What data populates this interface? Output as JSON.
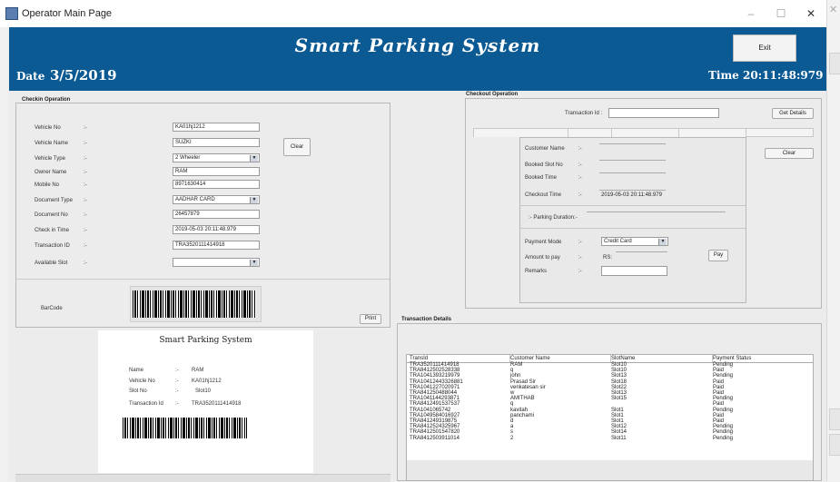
{
  "window": {
    "title": "Operator Main Page",
    "minimize": "–",
    "maximize": "☐",
    "close": "✕"
  },
  "header": {
    "brand": "Smart Parking System",
    "exit_label": "Exit",
    "date_label": "Date",
    "date_value": "3/5/2019",
    "time_label": "Time",
    "time_value": "20:11:48:979"
  },
  "checkin": {
    "title": "Checkin Operation",
    "fields": [
      {
        "label": "Vehicle No",
        "sep": ":-",
        "value": "KA01hj1212",
        "kind": "text"
      },
      {
        "label": "Vehicle Name",
        "sep": ":-",
        "value": "SUZKI",
        "kind": "text"
      },
      {
        "label": "Vehicle Type",
        "sep": ":-",
        "value": "2 Wheeler",
        "kind": "combo"
      },
      {
        "label": "Owner Name",
        "sep": ":-",
        "value": "RAM",
        "kind": "text"
      },
      {
        "label": "Mobile No",
        "sep": ":-",
        "value": "8971630414",
        "kind": "text"
      },
      {
        "label": "Document Type",
        "sep": ":-",
        "value": "AADHAR CARD",
        "kind": "combo"
      },
      {
        "label": "Document No",
        "sep": ":-",
        "value": "26457879",
        "kind": "text"
      },
      {
        "label": "Check in Time",
        "sep": ":-",
        "value": "2019-05-03 20:11:48.979",
        "kind": "text"
      },
      {
        "label": "Transaction ID",
        "sep": ":-",
        "value": "TRA3520111414918",
        "kind": "text"
      },
      {
        "label": "Available Slot",
        "sep": ":-",
        "value": "",
        "kind": "combo"
      }
    ],
    "clear_label": "Clear",
    "barcode_label": "BarCode",
    "print_label": "Print"
  },
  "ticket": {
    "title": "Smart Parking System",
    "rows": [
      {
        "label": "Name",
        "sep": ":-",
        "value": "RAM"
      },
      {
        "label": "Vehicle No",
        "sep": ":-",
        "value": "KA01hj1212"
      },
      {
        "label": "Slot No",
        "sep": ":-",
        "value": "Slot10"
      },
      {
        "label": "Transaction Id",
        "sep": ":-",
        "value": "TRA3520111414918"
      }
    ]
  },
  "checkout": {
    "title": "Checkout Operation",
    "transaction_label": "Transaction Id :",
    "transaction_value": "",
    "get_details_label": "Get Details",
    "clear_label": "Clear",
    "customer_name_label": "Customer Name",
    "customer_name_sep": ":-",
    "booked_slot_label": "Booked Slot No",
    "booked_slot_sep": ":-",
    "booked_time_label": "Booked Time",
    "booked_time_sep": ":-",
    "checkout_time_label": "Checkout Time",
    "checkout_time_sep": ":-",
    "checkout_time_value": "2019-05-03 20:11:48.979",
    "duration_label": ":- Parking Duration:-",
    "payment_mode_label": "Payment Mode",
    "payment_mode_sep": ":-",
    "payment_mode_value": "Credit Card",
    "amount_label": "Amount to pay",
    "amount_sep": ":-",
    "currency": "RS:",
    "pay_label": "Pay",
    "remarks_label": "Remarks",
    "remarks_sep": ":-"
  },
  "transactions": {
    "title": "Transaction Details",
    "columns": [
      "TransId",
      "Customer Name",
      "SlotName",
      "Payment Status"
    ],
    "rows": [
      [
        "TRA3520111414918",
        "RAM",
        "Slot10",
        "Pending"
      ],
      [
        "TRA8412502528338",
        "q",
        "Slot10",
        "Paid"
      ],
      [
        "TRA1041393219979",
        "john",
        "Slot13",
        "Pending"
      ],
      [
        "TRA10412443326881",
        "Prasad Sir",
        "Slot18",
        "Paid"
      ],
      [
        "TRA1041227020971",
        "venkatesan sir",
        "Slot22",
        "Paid"
      ],
      [
        "TRA841250488044",
        "w",
        "Slot13",
        "Paid"
      ],
      [
        "TRA1041144293871",
        "AMITHAB",
        "Slot15",
        "Pending"
      ],
      [
        "TRA8412491537537",
        "q",
        "",
        "Paid"
      ],
      [
        "TRA1041065742",
        "kavitah",
        "Slot1",
        "Pending"
      ],
      [
        "TRA1049584016927",
        "panchami",
        "Slot1",
        "Paid"
      ],
      [
        "TRA841249319875",
        "d",
        "Slot1",
        "Paid"
      ],
      [
        "TRA8412524325967",
        "a",
        "Slot12",
        "Pending"
      ],
      [
        "TRA8412501547820",
        "s",
        "Slot14",
        "Pending"
      ],
      [
        "TRA8412503911014",
        "2",
        "Slot11",
        "Pending"
      ]
    ]
  }
}
